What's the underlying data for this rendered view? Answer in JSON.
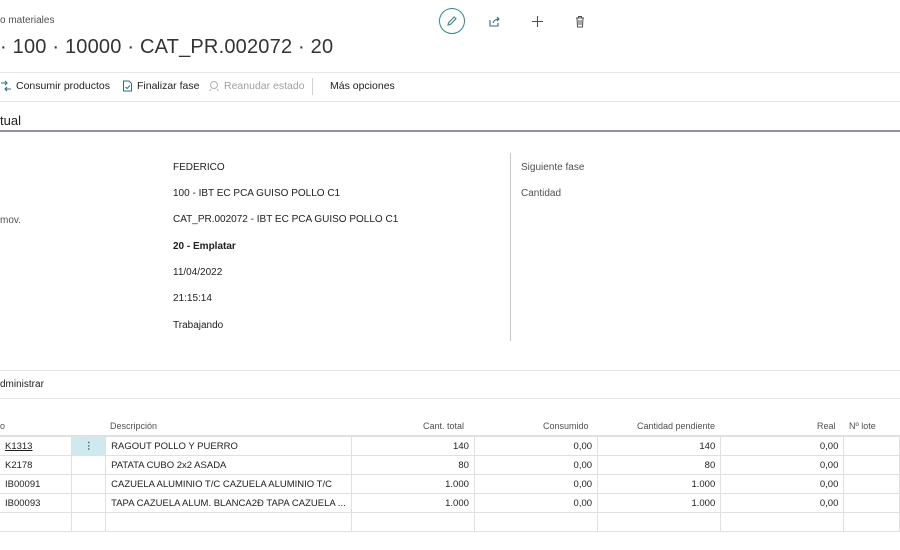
{
  "header": {
    "breadcrumb": "o materiales",
    "title": "· 100 · 10000 · CAT_PR.002072 · 20"
  },
  "actions": {
    "consumir": "Consumir productos",
    "finalizar": "Finalizar fase",
    "reanudar": "Reanudar estado",
    "mas": "Más opciones"
  },
  "section": {
    "title": "tual"
  },
  "general": {
    "left_label_mov": "mov.",
    "values": [
      "FEDERICO",
      "100 - IBT EC PCA GUISO POLLO C1",
      "CAT_PR.002072 - IBT EC PCA GUISO POLLO C1",
      "20 - Emplatar",
      "11/04/2022",
      "21:15:14",
      "Trabajando"
    ],
    "right_labels": [
      "Siguiente fase",
      "Cantidad"
    ]
  },
  "subpage": {
    "label": "dministrar",
    "columns": {
      "code": "o",
      "descripcion": "Descripción",
      "cant_total": "Cant. total",
      "consumido": "Consumido",
      "pendiente": "Cantidad pendiente",
      "real": "Real",
      "lote": "Nº lote"
    },
    "rows": [
      {
        "code": "K1313",
        "desc": "RAGOUT POLLO Y PUERRO",
        "total": "140",
        "consumido": "0,00",
        "pendiente": "140",
        "real": "0,00",
        "lote": ""
      },
      {
        "code": "K2178",
        "desc": "PATATA CUBO 2x2 ASADA",
        "total": "80",
        "consumido": "0,00",
        "pendiente": "80",
        "real": "0,00",
        "lote": ""
      },
      {
        "code": "IB00091",
        "desc": "CAZUELA ALUMINIO T/C  CAZUELA ALUMINIO T/C",
        "total": "1.000",
        "consumido": "0,00",
        "pendiente": "1.000",
        "real": "0,00",
        "lote": ""
      },
      {
        "code": "IB00093",
        "desc": "TAPA CAZUELA ALUM. BLANCA2Ð  TAPA CAZUELA ...",
        "total": "1.000",
        "consumido": "0,00",
        "pendiente": "1.000",
        "real": "0,00",
        "lote": ""
      }
    ],
    "row_menu_glyph": "⋮"
  },
  "icons": {
    "edit": "edit-pencil-icon",
    "share": "share-icon",
    "new": "plus-icon",
    "delete": "trash-icon"
  },
  "colors": {
    "accent": "#2e8b87",
    "section_rule": "#8f8fa8",
    "selected_cell": "#cfe9ef"
  }
}
